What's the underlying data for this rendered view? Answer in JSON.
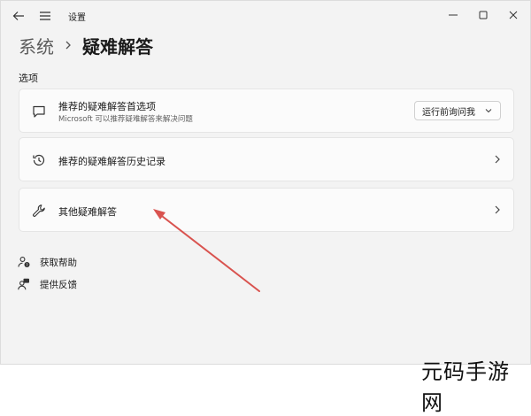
{
  "window": {
    "title": "设置",
    "back_icon": "arrow-left-icon",
    "menu_icon": "hamburger-menu-icon",
    "controls": [
      "minimize-icon",
      "maximize-icon",
      "close-icon"
    ]
  },
  "breadcrumb": {
    "parent": "系统",
    "separator_icon": "chevron-right-icon",
    "current": "疑难解答"
  },
  "section": {
    "label": "选项"
  },
  "cards": {
    "recommended": {
      "icon": "chat-bubble-icon",
      "title": "推荐的疑难解答首选项",
      "subtitle": "Microsoft 可以推荐疑难解答来解决问题",
      "dropdown_value": "运行前询问我"
    },
    "history": {
      "icon": "history-icon",
      "title": "推荐的疑难解答历史记录"
    },
    "other": {
      "icon": "wrench-icon",
      "title": "其他疑难解答"
    }
  },
  "links": {
    "help": {
      "icon": "help-person-icon",
      "label": "获取帮助"
    },
    "feedback": {
      "icon": "feedback-person-icon",
      "label": "提供反馈"
    }
  },
  "brand": {
    "text": "元码手游网"
  },
  "colors": {
    "window_bg": "#f3f3f3",
    "card_bg": "#fbfbfb",
    "annotation_arrow": "#d9534f"
  }
}
